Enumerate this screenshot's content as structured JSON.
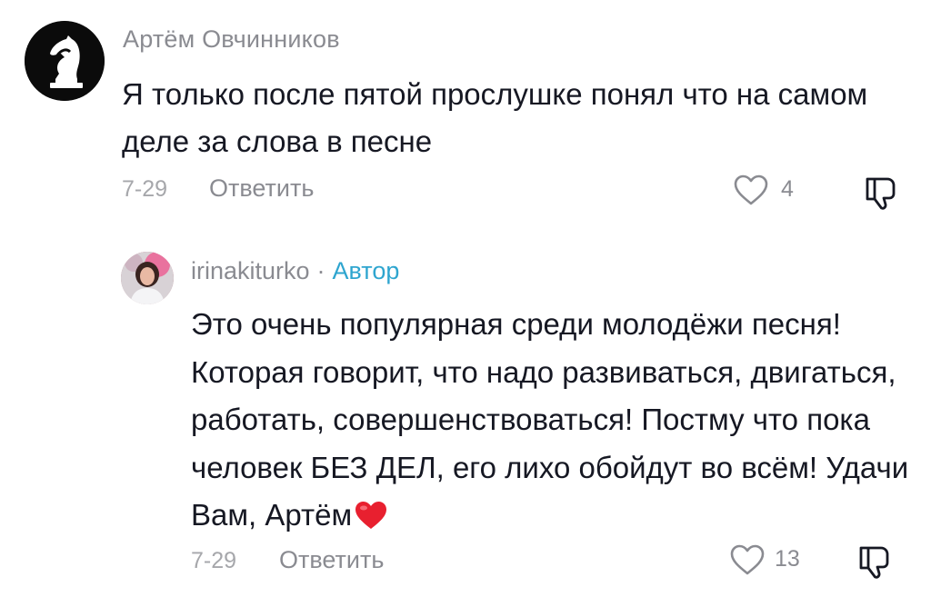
{
  "comment": {
    "avatar_icon": "knight-chess-logo-icon",
    "username": "Артём Овчинников",
    "text": "Я только после пятой прослушке понял что на самом деле за слова в песне",
    "date": "7-29",
    "reply_label": "Ответить",
    "like_count": "4"
  },
  "reply": {
    "username": "irinakiturko",
    "separator": "·",
    "author_badge": "Автор",
    "text": "Это очень популярная среди молодёжи песня! Которая говорит, что надо развиваться, двигаться, работать, совершенствоваться! Постму что пока человек БЕЗ ДЕЛ, его лихо обойдут во всём! Удачи Вам, Артём",
    "emoji": "red-heart-emoji",
    "date": "7-29",
    "reply_label": "Ответить",
    "like_count": "13"
  },
  "colors": {
    "primary_text": "#161823",
    "secondary_text": "#8a8b91",
    "author_badge": "#2ea5cf",
    "heart_emoji": "#e8202f"
  }
}
